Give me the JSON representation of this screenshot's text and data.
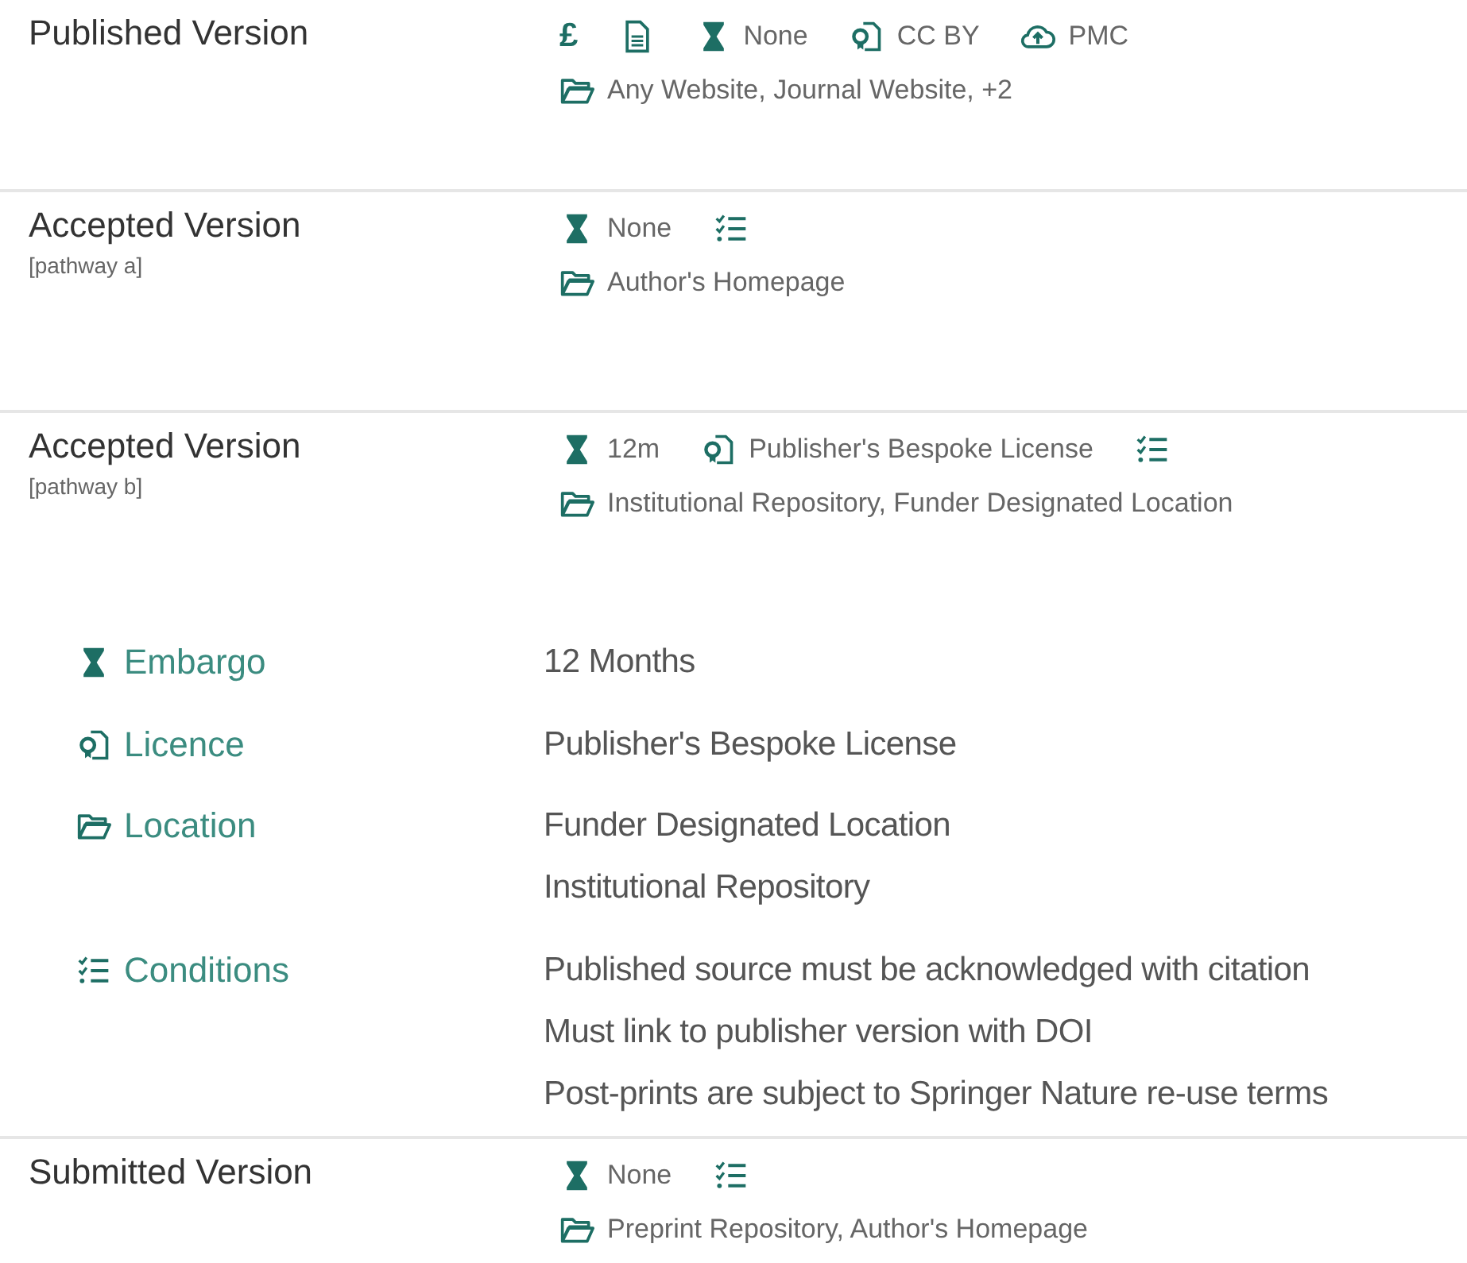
{
  "versions": [
    {
      "title": "Published Version",
      "meta": [
        {
          "kind": "symbol",
          "text": "£"
        },
        {
          "kind": "document"
        },
        {
          "kind": "embargo",
          "text": "None"
        },
        {
          "kind": "licence",
          "text": "CC BY"
        },
        {
          "kind": "deposit",
          "text": "PMC"
        }
      ],
      "locations": "Any Website, Journal Website, +2"
    },
    {
      "title": "Accepted Version",
      "subtitle": "[pathway a]",
      "meta": [
        {
          "kind": "embargo",
          "text": "None"
        },
        {
          "kind": "conditions"
        }
      ],
      "locations": "Author's Homepage"
    },
    {
      "title": "Accepted Version",
      "subtitle": "[pathway b]",
      "meta": [
        {
          "kind": "embargo",
          "text": "12m"
        },
        {
          "kind": "licence",
          "text": "Publisher's Bespoke License"
        },
        {
          "kind": "conditions"
        }
      ],
      "locations": "Institutional Repository, Funder Designated Location",
      "details": [
        {
          "kind": "embargo",
          "label": "Embargo",
          "values": [
            "12 Months"
          ]
        },
        {
          "kind": "licence",
          "label": "Licence",
          "values": [
            "Publisher's Bespoke License"
          ]
        },
        {
          "kind": "location",
          "label": "Location",
          "values": [
            "Funder Designated Location",
            "Institutional Repository"
          ]
        },
        {
          "kind": "conditions",
          "label": "Conditions",
          "values": [
            "Published source must be acknowledged with citation",
            "Must link to publisher version with DOI",
            "Post-prints are subject to Springer Nature re-use terms"
          ]
        }
      ]
    },
    {
      "title": "Submitted Version",
      "meta": [
        {
          "kind": "embargo",
          "text": "None"
        },
        {
          "kind": "conditions"
        }
      ],
      "locations": "Preprint Repository, Author's Homepage"
    }
  ]
}
